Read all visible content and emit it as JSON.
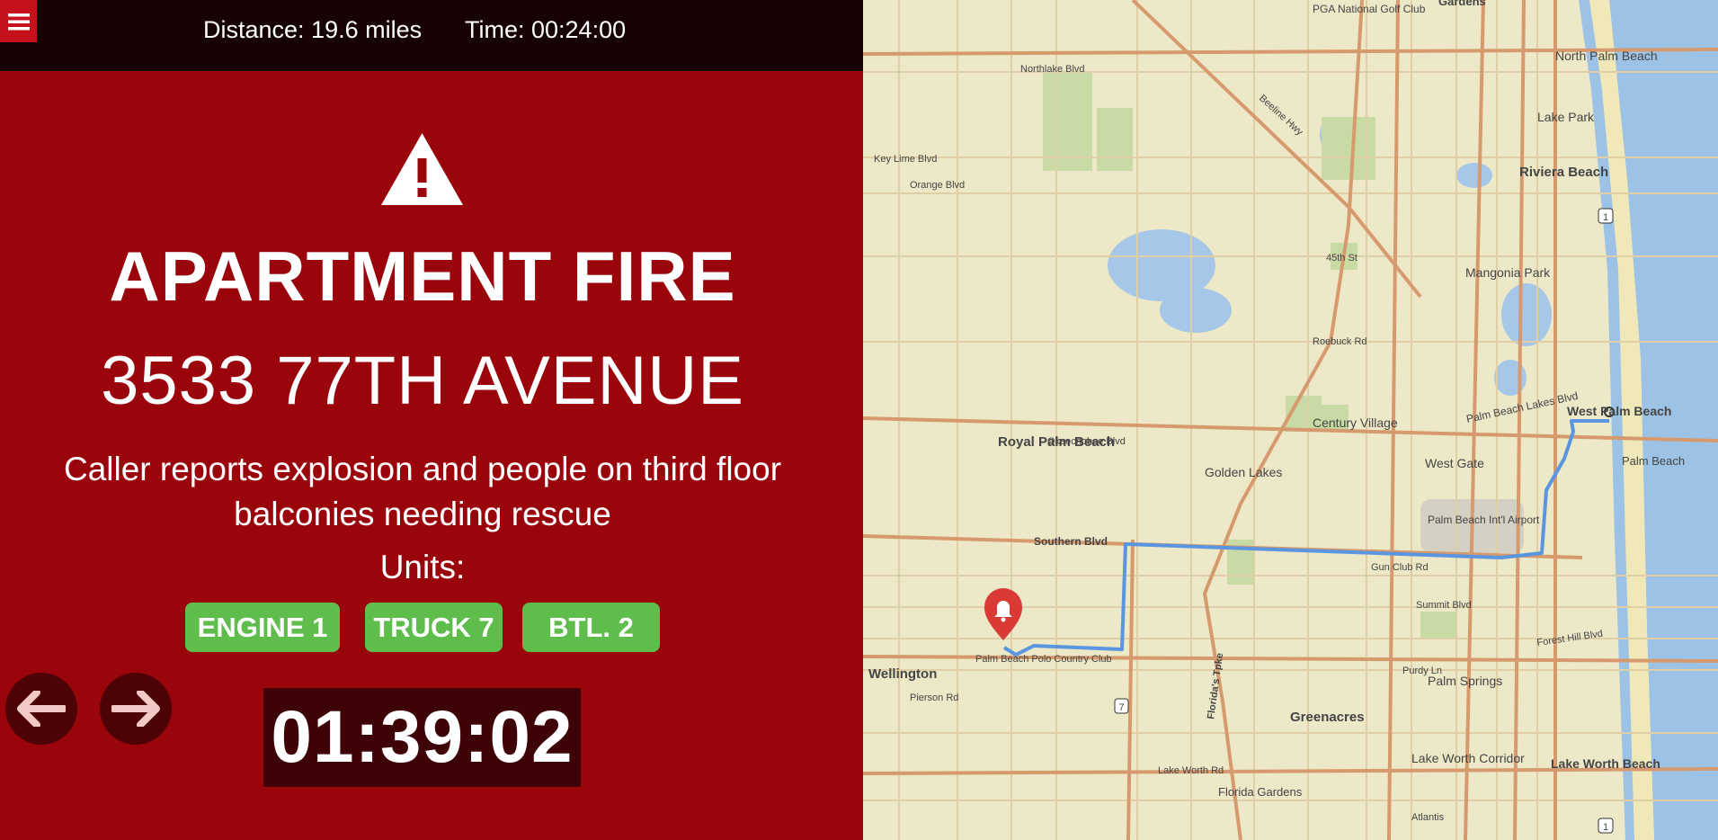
{
  "header": {
    "menu_icon": "hamburger-icon",
    "distance": "Distance: 19.6 miles",
    "time": "Time: 00:24:00"
  },
  "incident": {
    "alert_icon": "warning-triangle-icon",
    "type": "APARTMENT FIRE",
    "address": "3533 77TH AVENUE",
    "description": "Caller reports explosion and people on third floor balconies needing rescue",
    "units_label": "Units:",
    "units": [
      "ENGINE 1",
      "TRUCK 7",
      "BTL. 2"
    ]
  },
  "navigation": {
    "prev_icon": "arrow-left-icon",
    "next_icon": "arrow-right-icon"
  },
  "elapsed_timer": "01:39:02",
  "map": {
    "marker_icon": "bell-marker-icon",
    "labels": {
      "pga_golf": "PGA National Golf Club",
      "gardens": "Gardens",
      "north_palm_beach": "North Palm Beach",
      "lake_park": "Lake Park",
      "riviera_beach": "Riviera Beach",
      "mangonia_park": "Mangonia Park",
      "northlake_blvd": "Northlake Blvd",
      "key_lime_blvd": "Key Lime Blvd",
      "orange_blvd": "Orange Blvd",
      "beeline_hwy": "Beeline Hwy",
      "st_45th": "45th St",
      "roebuck_rd": "Roebuck Rd",
      "palm_beach_lakes_blvd": "Palm Beach Lakes Blvd",
      "west_palm_beach": "West Palm Beach",
      "century_village": "Century Village",
      "okeechobee_blvd": "Okeechobee Blvd",
      "royal_palm_beach": "Royal Palm Beach",
      "golden_lakes": "Golden Lakes",
      "west_gate": "West Gate",
      "palm_beach": "Palm Beach",
      "airport": "Palm Beach Int'l Airport",
      "southern_blvd": "Southern Blvd",
      "gun_club_rd": "Gun Club Rd",
      "summit_blvd": "Summit Blvd",
      "forest_hill_blvd": "Forest Hill Blvd",
      "purdy_ln": "Purdy Ln",
      "wellington": "Wellington",
      "polo_club": "Palm Beach Polo Country Club",
      "pierson_rd": "Pierson Rd",
      "palm_springs": "Palm Springs",
      "greenacres": "Greenacres",
      "florida_tpke": "Florida's Tpke",
      "lake_worth_rd": "Lake Worth Rd",
      "lake_worth_corridor": "Lake Worth Corridor",
      "lake_worth_beach": "Lake Worth Beach",
      "florida_gardens": "Florida Gardens",
      "atlantis": "Atlantis",
      "route_1": "1",
      "route_7": "7"
    }
  }
}
